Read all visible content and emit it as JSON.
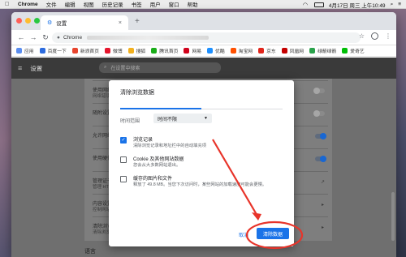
{
  "mac_menubar": {
    "app_name": "Chrome",
    "menus": [
      "文件",
      "编辑",
      "视图",
      "历史记录",
      "书签",
      "用户",
      "窗口",
      "帮助"
    ],
    "clock": "4月17日 周三 上午10:49"
  },
  "browser": {
    "tab_title": "设置",
    "tab_close": "×",
    "new_tab": "+",
    "omnibox_text": "Chrome",
    "bookmarks": [
      {
        "label": "应用",
        "color": "#5b8def"
      },
      {
        "label": "百度一下",
        "color": "#2d6cdf"
      },
      {
        "label": "新浪首页",
        "color": "#e8452e"
      },
      {
        "label": "微博",
        "color": "#e6162d"
      },
      {
        "label": "搜狐",
        "color": "#f2b01e"
      },
      {
        "label": "腾讯首页",
        "color": "#1aad19"
      },
      {
        "label": "网易",
        "color": "#d0021b"
      },
      {
        "label": "优酷",
        "color": "#1e90ff"
      },
      {
        "label": "淘宝网",
        "color": "#ff5000"
      },
      {
        "label": "京东",
        "color": "#e1251b"
      },
      {
        "label": "凤凰网",
        "color": "#c40000"
      },
      {
        "label": "绿箭绿箭",
        "color": "#2aa24b"
      },
      {
        "label": "爱奇艺",
        "color": "#00be06"
      }
    ]
  },
  "settings": {
    "title": "设置",
    "search_placeholder": "在设置中搜索",
    "rows": [
      {
        "t1": "使用网络服务",
        "t2": "网络错误或..."
      },
      {
        "t1": "随附设置",
        "t2": ""
      },
      {
        "t1": "允许网络",
        "t2": ""
      },
      {
        "t1": "使用硬件",
        "t2": ""
      },
      {
        "t1": "管理证书",
        "t2": "管理 HTTP..."
      },
      {
        "t1": "内容设置",
        "t2": "控制网站可..."
      },
      {
        "t1": "清除浏览数据",
        "t2": "清除浏览记录..."
      }
    ],
    "section_language": "语言"
  },
  "dialog": {
    "title": "清除浏览数据",
    "range_label": "时间范围",
    "range_value": "时间不限",
    "options": [
      {
        "title": "浏览记录",
        "desc": "清除浏览记录和地址栏中的自动填充项",
        "checked": true
      },
      {
        "title": "Cookie 及其他网站数据",
        "desc": "您会从大多数网站退出。",
        "checked": false
      },
      {
        "title": "缓存的图片和文件",
        "desc": "释放了 49.8 MB。当您下次访问时，某些网站的加载速度可能会更慢。",
        "checked": false
      }
    ],
    "cancel_label": "取消",
    "confirm_label": "清除数据"
  },
  "colors": {
    "accent": "#1a73e8",
    "annotation": "#e8342a"
  }
}
